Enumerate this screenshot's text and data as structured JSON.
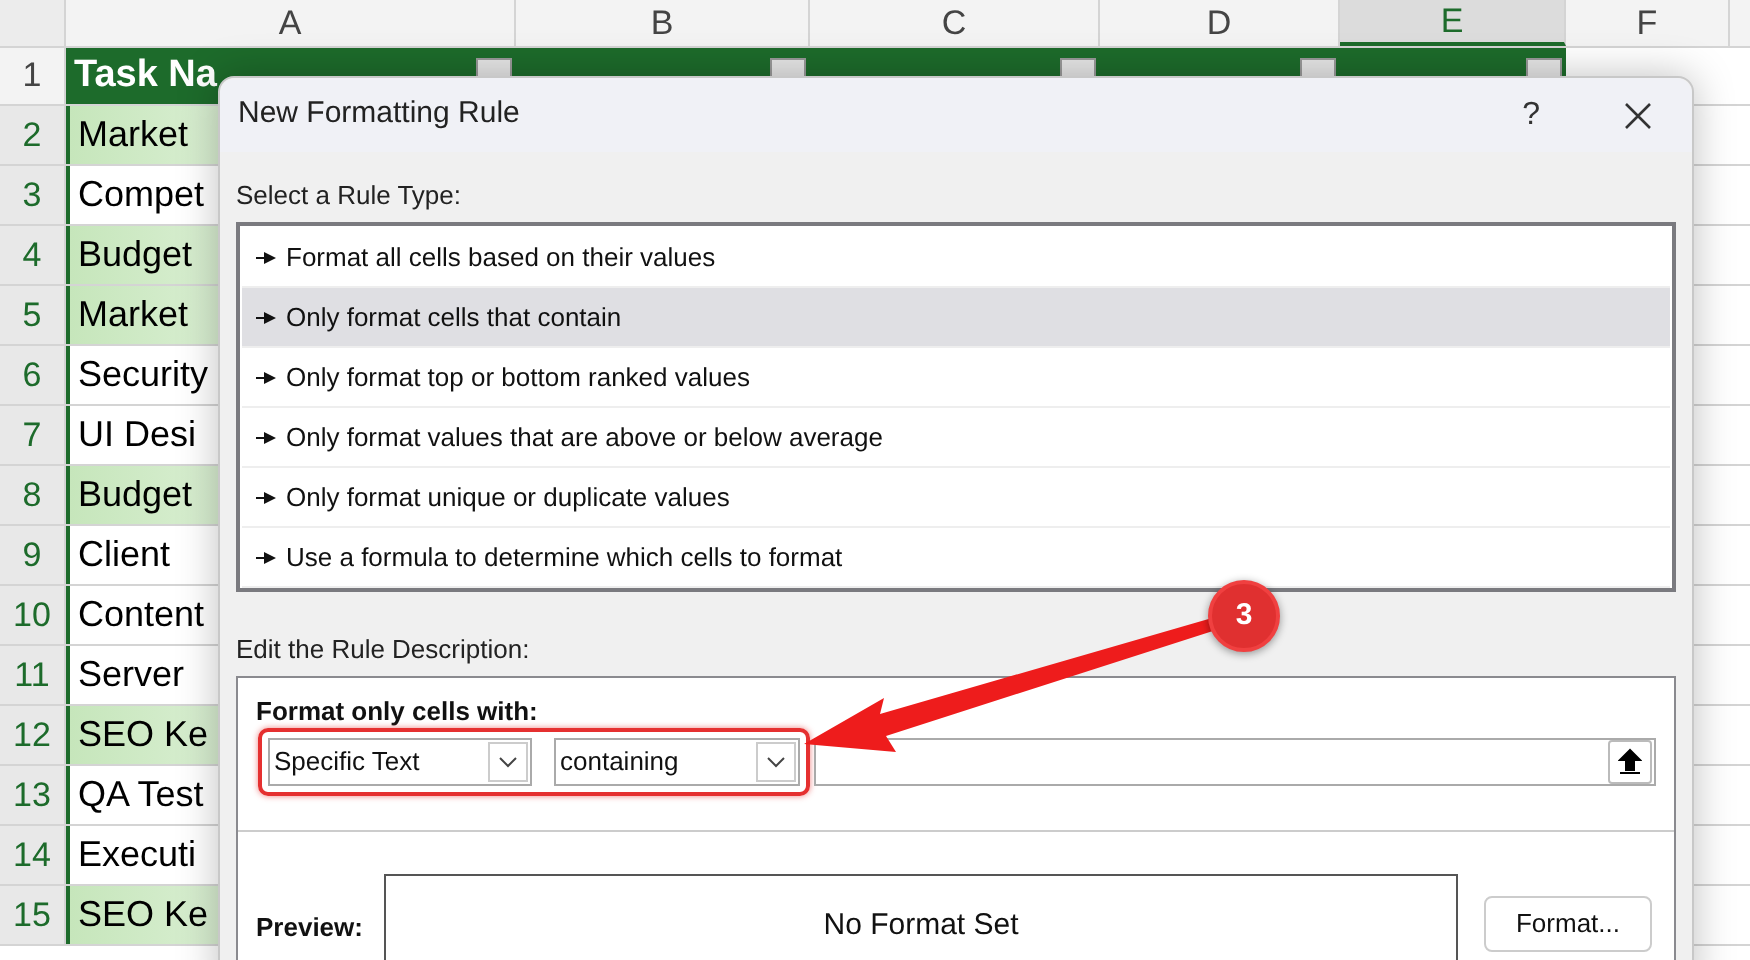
{
  "sheet": {
    "columns": [
      {
        "label": "A",
        "selected": false
      },
      {
        "label": "B",
        "selected": false
      },
      {
        "label": "C",
        "selected": false
      },
      {
        "label": "D",
        "selected": false
      },
      {
        "label": "E",
        "selected": true
      },
      {
        "label": "F",
        "selected": false
      }
    ],
    "header_row": {
      "row": "1",
      "title": "Task Na"
    },
    "rows": [
      {
        "row": "2",
        "cell": "Market",
        "highlighted": true
      },
      {
        "row": "3",
        "cell": "Compet",
        "highlighted": false
      },
      {
        "row": "4",
        "cell": "Budget",
        "highlighted": true
      },
      {
        "row": "5",
        "cell": "Market",
        "highlighted": true
      },
      {
        "row": "6",
        "cell": "Security",
        "highlighted": false
      },
      {
        "row": "7",
        "cell": "UI Desi",
        "highlighted": false
      },
      {
        "row": "8",
        "cell": "Budget",
        "highlighted": true
      },
      {
        "row": "9",
        "cell": "Client",
        "highlighted": false
      },
      {
        "row": "10",
        "cell": "Content",
        "highlighted": false
      },
      {
        "row": "11",
        "cell": "Server",
        "highlighted": false
      },
      {
        "row": "12",
        "cell": "SEO Ke",
        "highlighted": true
      },
      {
        "row": "13",
        "cell": "QA Test",
        "highlighted": false
      },
      {
        "row": "14",
        "cell": "Executi",
        "highlighted": false
      },
      {
        "row": "15",
        "cell": "SEO Ke",
        "highlighted": true
      }
    ]
  },
  "dialog": {
    "title": "New Formatting Rule",
    "help": "?",
    "rule_type_label": "Select a Rule Type:",
    "rule_types": [
      {
        "label": "Format all cells based on their values",
        "selected": false
      },
      {
        "label": "Only format cells that contain",
        "selected": true
      },
      {
        "label": "Only format top or bottom ranked values",
        "selected": false
      },
      {
        "label": "Only format values that are above or below average",
        "selected": false
      },
      {
        "label": "Only format unique or duplicate values",
        "selected": false
      },
      {
        "label": "Use a formula to determine which cells to format",
        "selected": false
      }
    ],
    "description_label": "Edit the Rule Description:",
    "format_label": "Format only cells with:",
    "condition_dropdowns": [
      {
        "value": "Specific Text"
      },
      {
        "value": "containing"
      }
    ],
    "preview_label": "Preview:",
    "preview_text": "No Format Set",
    "format_button": "Format..."
  },
  "callout": {
    "number": "3"
  }
}
